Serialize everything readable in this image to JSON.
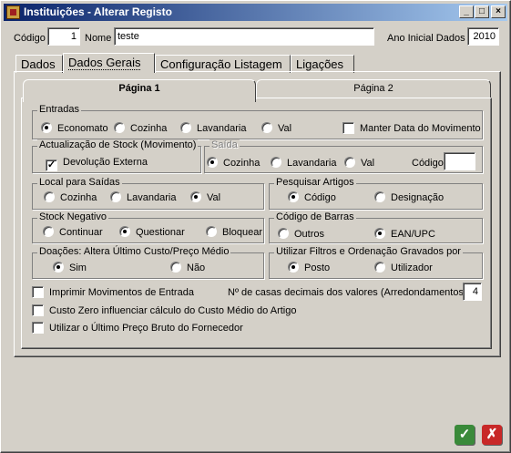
{
  "window": {
    "title": "Instituições - Alterar Registo",
    "buttons": {
      "minimize": "_",
      "maximize": "□",
      "close": "×"
    }
  },
  "header": {
    "codigo_label": "Código",
    "codigo_value": "1",
    "nome_label": "Nome",
    "nome_value": "teste",
    "ano_label": "Ano Inicial Dados",
    "ano_value": "2010"
  },
  "tabs": [
    "Dados",
    "Dados Gerais",
    "Configuração Listagem",
    "Ligações"
  ],
  "active_tab": "Dados Gerais",
  "subtabs": [
    "Página 1",
    "Página 2"
  ],
  "active_subtab": "Página 1",
  "entradas": {
    "title": "Entradas",
    "options": [
      "Economato",
      "Cozinha",
      "Lavandaria",
      "Val"
    ],
    "selected": "Economato",
    "manter_label": "Manter Data do Movimento",
    "manter_checked": false
  },
  "actualizacao": {
    "title": "Actualização de Stock (Movimento)",
    "devolucao_label": "Devolução Externa",
    "devolucao_checked": true
  },
  "saida": {
    "title": "Saída",
    "options": [
      "Cozinha",
      "Lavandaria",
      "Val"
    ],
    "selected": "Cozinha",
    "codigo_label": "Código",
    "codigo_value": ""
  },
  "local_saidas": {
    "title": "Local para Saídas",
    "options": [
      "Cozinha",
      "Lavandaria",
      "Val"
    ],
    "selected": "Val"
  },
  "pesquisar": {
    "title": "Pesquisar Artigos",
    "options": [
      "Código",
      "Designação"
    ],
    "selected": "Código"
  },
  "stock_negativo": {
    "title": "Stock Negativo",
    "options": [
      "Continuar",
      "Questionar",
      "Bloquear"
    ],
    "selected": "Questionar"
  },
  "codigo_barras": {
    "title": "Código de Barras",
    "options": [
      "Outros",
      "EAN/UPC"
    ],
    "selected": "EAN/UPC"
  },
  "doacoes": {
    "title": "Doações: Altera Último Custo/Preço Médio",
    "options": [
      "Sim",
      "Não"
    ],
    "selected": "Sim"
  },
  "filtros": {
    "title": "Utilizar Filtros e Ordenação Gravados por",
    "options": [
      "Posto",
      "Utilizador"
    ],
    "selected": "Posto"
  },
  "checkboxes": {
    "imprimir": {
      "label": "Imprimir Movimentos de Entrada",
      "checked": false
    },
    "custo_zero": {
      "label": "Custo Zero influenciar cálculo do Custo Médio do Artigo",
      "checked": false
    },
    "ultimo_preco": {
      "label": "Utilizar o Último Preço Bruto do Fornecedor",
      "checked": false
    }
  },
  "casas_decimais": {
    "label": "Nº de casas decimais dos valores (Arredondamentos)",
    "value": "4"
  },
  "actions": {
    "ok": "✓",
    "cancel": "✗"
  },
  "colors": {
    "ok": "#3a8a3a",
    "cancel": "#c82828",
    "titlebar": "#0a246a"
  }
}
